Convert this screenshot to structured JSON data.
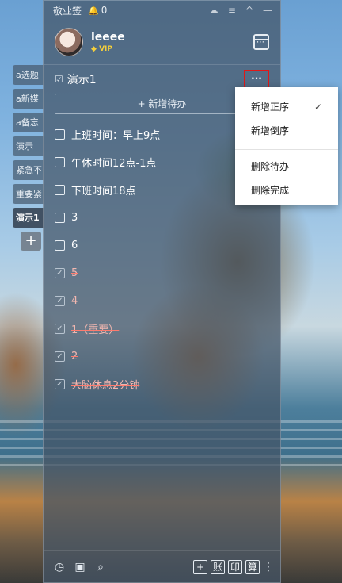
{
  "window": {
    "app_title": "敬业签",
    "notification_count": "0"
  },
  "side_tabs": [
    {
      "label": "a选题"
    },
    {
      "label": "a新媒"
    },
    {
      "label": "a备忘"
    },
    {
      "label": "演示"
    },
    {
      "label": "紧急不"
    },
    {
      "label": "重要紧"
    },
    {
      "label": "演示1"
    }
  ],
  "side_add_label": "+",
  "profile": {
    "username": "leeee",
    "badge": "VIP"
  },
  "list": {
    "title": "演示1",
    "more_label": "···",
    "add_todo_label": "+ 新增待办"
  },
  "todos": [
    {
      "text": "上班时间：早上9点",
      "done": false
    },
    {
      "text": "午休时间12点-1点",
      "done": false
    },
    {
      "text": "下班时间18点",
      "done": false
    },
    {
      "text": "3",
      "done": false
    },
    {
      "text": "6",
      "done": false
    },
    {
      "text": "5",
      "done": true
    },
    {
      "text": "4",
      "done": true
    },
    {
      "text": "1（重要）",
      "done": true
    },
    {
      "text": "2",
      "done": true
    },
    {
      "text": "大脑休息2分钟",
      "done": true
    }
  ],
  "menu": {
    "items_top": [
      "新增正序",
      "新增倒序"
    ],
    "checked_item": "新增正序",
    "items_bottom": [
      "删除待办",
      "删除完成"
    ]
  },
  "bottombar": {
    "buttons": [
      "+",
      "账",
      "印",
      "算"
    ]
  },
  "colors": {
    "highlight_border": "#e01818",
    "vip_gold": "#f5cf3b",
    "done_text": "#f2b7b0"
  }
}
